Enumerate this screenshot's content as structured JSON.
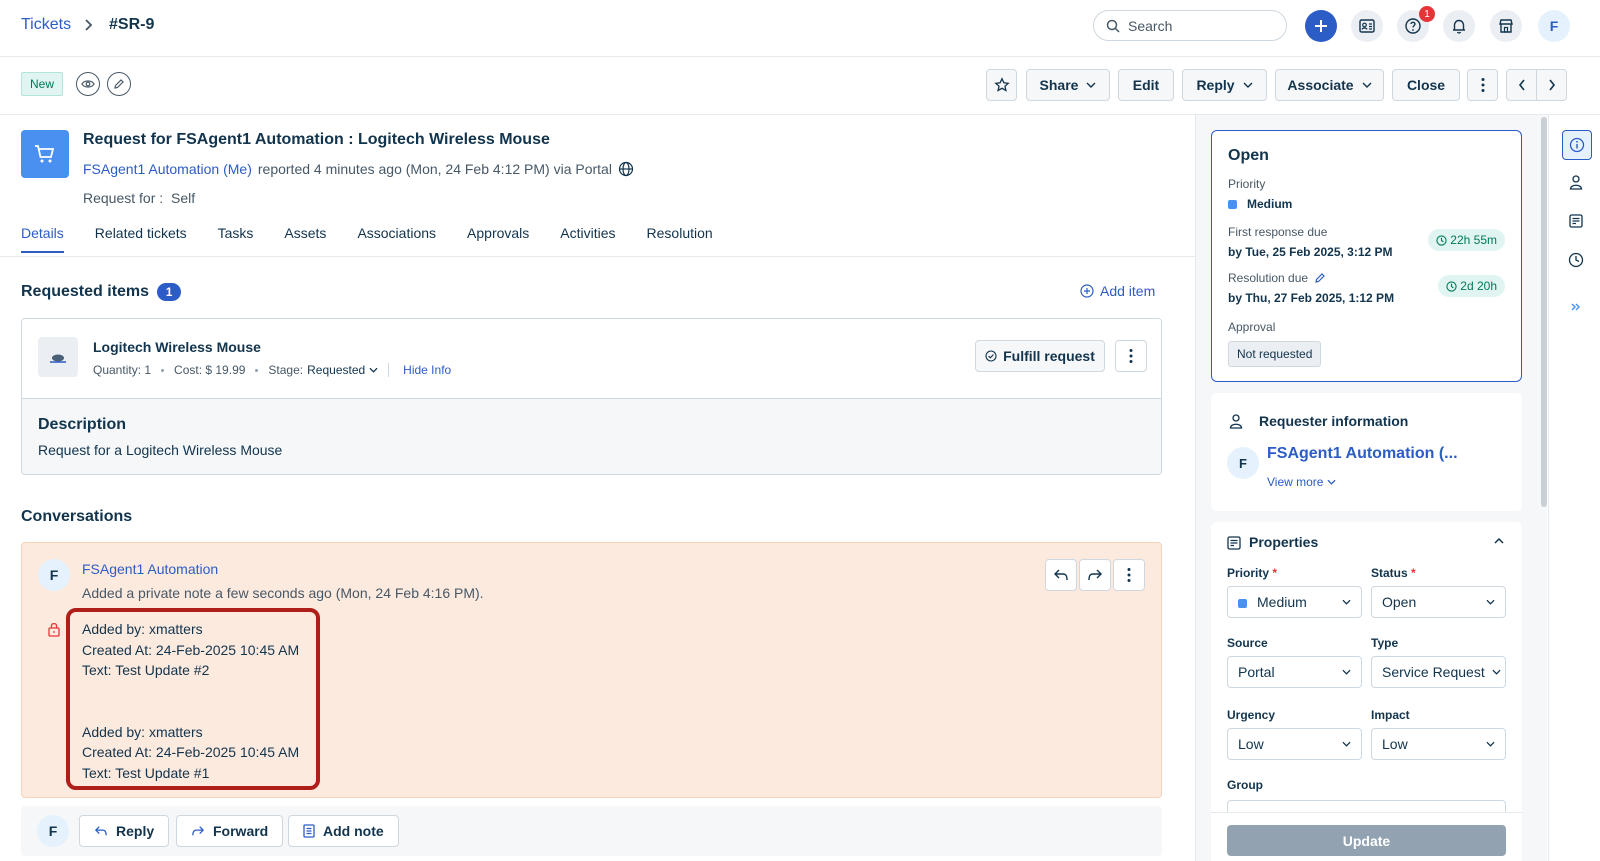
{
  "breadcrumb": {
    "root": "Tickets",
    "separator": "›",
    "current": "#SR-9"
  },
  "topbar": {
    "search_placeholder": "Search",
    "notification_count": "1",
    "user_initial": "F"
  },
  "actionbar": {
    "status_badge": "New",
    "share": "Share",
    "edit": "Edit",
    "reply": "Reply",
    "associate": "Associate",
    "close": "Close"
  },
  "ticket": {
    "title": "Request for FSAgent1 Automation : Logitech Wireless Mouse",
    "requester_link": "FSAgent1 Automation (Me)",
    "reported": "reported 4 minutes ago (Mon, 24 Feb 4:12 PM) via Portal",
    "request_for_label": "Request for :",
    "request_for_value": "Self"
  },
  "tabs": [
    "Details",
    "Related tickets",
    "Tasks",
    "Assets",
    "Associations",
    "Approvals",
    "Activities",
    "Resolution"
  ],
  "requested_items": {
    "title": "Requested items",
    "count": "1",
    "add_item": "Add item",
    "item": {
      "name": "Logitech Wireless Mouse",
      "quantity": "Quantity: 1",
      "cost": "Cost: $ 19.99",
      "stage_label": "Stage:",
      "stage_value": "Requested",
      "hide_info": "Hide Info",
      "fulfill": "Fulfill request",
      "description_title": "Description",
      "description_text": "Request for a Logitech Wireless Mouse"
    }
  },
  "conversations": {
    "title": "Conversations",
    "entry": {
      "avatar": "F",
      "author": "FSAgent1 Automation",
      "subtitle": "Added a private note a few seconds ago (Mon, 24 Feb 4:16 PM).",
      "lines": [
        "Added by: xmatters",
        "Created At: 24-Feb-2025 10:45 AM",
        "Text: Test Update #2",
        "",
        "",
        "Added by: xmatters",
        "Created At: 24-Feb-2025 10:45 AM",
        "Text: Test Update #1"
      ]
    },
    "reply_bar": {
      "avatar": "F",
      "reply": "Reply",
      "forward": "Forward",
      "add_note": "Add note"
    }
  },
  "status_card": {
    "status": "Open",
    "priority_label": "Priority",
    "priority_value": "Medium",
    "first_response_label": "First response due",
    "first_response_value": "by Tue, 25 Feb 2025, 3:12 PM",
    "first_response_sla": "22h 55m",
    "resolution_label": "Resolution due",
    "resolution_value": "by Thu, 27 Feb 2025, 1:12 PM",
    "resolution_sla": "2d 20h",
    "approval_label": "Approval",
    "approval_value": "Not requested"
  },
  "requester": {
    "title": "Requester information",
    "avatar": "F",
    "name": "FSAgent1 Automation (...",
    "view_more": "View more"
  },
  "properties": {
    "title": "Properties",
    "priority_label": "Priority",
    "priority_value": "Medium",
    "status_label": "Status",
    "status_value": "Open",
    "source_label": "Source",
    "source_value": "Portal",
    "type_label": "Type",
    "type_value": "Service Request",
    "urgency_label": "Urgency",
    "urgency_value": "Low",
    "impact_label": "Impact",
    "impact_value": "Low",
    "group_label": "Group",
    "required_mark": "*",
    "update": "Update"
  },
  "colors": {
    "accent": "#2c5cc5",
    "private_note_bg": "#fdeade",
    "highlight": "#b01e1a",
    "sla_green": "#00795b"
  }
}
